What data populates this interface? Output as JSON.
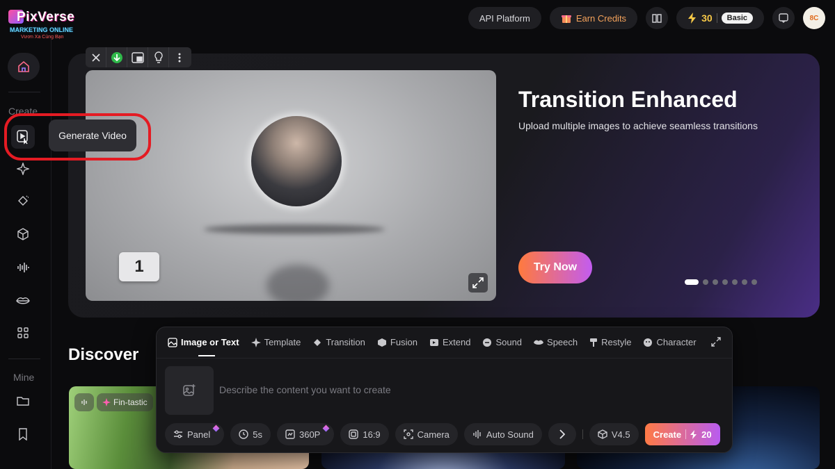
{
  "brand": {
    "name": "PixVerse",
    "watermark_line1": "MARKETING ONLINE",
    "watermark_line2": "Vươn Xa Cùng Bạn"
  },
  "topbar": {
    "api_platform": "API Platform",
    "earn_credits": "Earn Credits",
    "credits": "30",
    "plan": "Basic",
    "avatar_text": "8C"
  },
  "sidebar": {
    "create_label": "Create",
    "mine_label": "Mine",
    "icons": [
      "home-icon",
      "generate-video-icon",
      "sparkle-icon",
      "magic-wand-icon",
      "cube-icon",
      "soundwave-icon",
      "lips-icon",
      "grid-icon",
      "folder-icon",
      "bookmark-icon"
    ]
  },
  "tooltip": {
    "text": "Generate Video"
  },
  "hero": {
    "title": "Transition Enhanced",
    "subtitle": "Upload multiple images to achieve seamless transitions",
    "cta": "Try Now",
    "step_badge": "1",
    "slide_count": 7,
    "active_slide": 1
  },
  "discover": {
    "title": "Discover",
    "card1_chip": "Fin-tastic"
  },
  "create_panel": {
    "tabs": [
      {
        "label": "Image or Text",
        "icon": "image-icon",
        "active": true
      },
      {
        "label": "Template",
        "icon": "sparkle-icon"
      },
      {
        "label": "Transition",
        "icon": "wand-icon"
      },
      {
        "label": "Fusion",
        "icon": "cube-icon"
      },
      {
        "label": "Extend",
        "icon": "extend-icon"
      },
      {
        "label": "Sound",
        "icon": "sound-icon"
      },
      {
        "label": "Speech",
        "icon": "lips-icon"
      },
      {
        "label": "Restyle",
        "icon": "brush-icon"
      },
      {
        "label": "Character",
        "icon": "face-icon"
      }
    ],
    "prompt_placeholder": "Describe the content you want to create",
    "options": {
      "panel": "Panel",
      "duration": "5s",
      "resolution": "360P",
      "aspect": "16:9",
      "camera": "Camera",
      "auto_sound": "Auto Sound",
      "model": "V4.5"
    },
    "create_label": "Create",
    "create_cost": "20"
  },
  "colors": {
    "accent_orange": "#ff7a45",
    "accent_purple": "#b85cf0",
    "highlight_red": "#e41b23",
    "credit_yellow": "#f7c948"
  }
}
